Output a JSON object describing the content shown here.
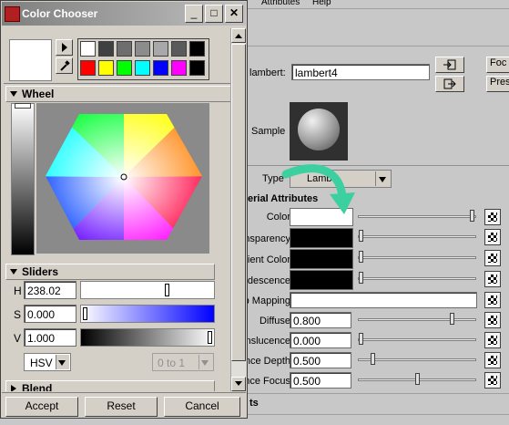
{
  "background_app": {
    "menubar": {
      "items": [
        "Attributes",
        "Help"
      ]
    },
    "node": {
      "label": "lambert:",
      "value": "lambert4",
      "btn_right1": "Foc",
      "btn_right2": "Pres"
    },
    "sample_label": "Sample",
    "type": {
      "label": "Type",
      "value": "Lamb"
    },
    "section_title": "erial Attributes",
    "attributes": [
      {
        "label": "Color",
        "kind": "swatch",
        "swatch": "#ffffff",
        "slider": 1.0
      },
      {
        "label": "Transparency",
        "kind": "swatch",
        "swatch": "#000000",
        "slider": 0.0
      },
      {
        "label": "Ambient Color",
        "kind": "swatch",
        "swatch": "#000000",
        "slider": 0.0
      },
      {
        "label": "Incandescence",
        "kind": "swatch",
        "swatch": "#000000",
        "slider": 0.0
      },
      {
        "label": "Bump Mapping",
        "kind": "text",
        "value": ""
      },
      {
        "label": "Diffuse",
        "kind": "number",
        "value": "0.800",
        "slider": 0.8
      },
      {
        "label": "Translucence",
        "kind": "number",
        "value": "0.000",
        "slider": 0.0
      },
      {
        "label": "Translucence Depth",
        "kind": "number",
        "value": "0.500",
        "slider": 0.1
      },
      {
        "label": "Translucence Focus",
        "kind": "number",
        "value": "0.500",
        "slider": 0.5
      }
    ],
    "footer_label": "ts",
    "accent_color": "#3ccfa0"
  },
  "chooser": {
    "title": "Color Chooser",
    "window_buttons": {
      "minimize": "_",
      "maximize": "□",
      "close": "✕"
    },
    "current_color": "#ffffff",
    "palette": [
      "#ffffff",
      "#404040",
      "#6e6e6e",
      "#8c8c8c",
      "#a8a8a8",
      "#5a5a5a",
      "#000000",
      "#ff0000",
      "#ffff00",
      "#00ff00",
      "#00ffff",
      "#0000ff",
      "#ff00ff",
      "#000000"
    ],
    "wheel": {
      "header": "Wheel"
    },
    "sliders": {
      "header": "Sliders",
      "h": {
        "label": "H",
        "value": "238.02",
        "fraction": 0.66
      },
      "s": {
        "label": "S",
        "value": "0.000",
        "fraction": 0.0
      },
      "v": {
        "label": "V",
        "value": "1.000",
        "fraction": 1.0
      },
      "mode": "HSV",
      "range": "0 to 1"
    },
    "blend": {
      "header": "Blend"
    },
    "buttons": {
      "accept": "Accept",
      "reset": "Reset",
      "cancel": "Cancel"
    }
  }
}
